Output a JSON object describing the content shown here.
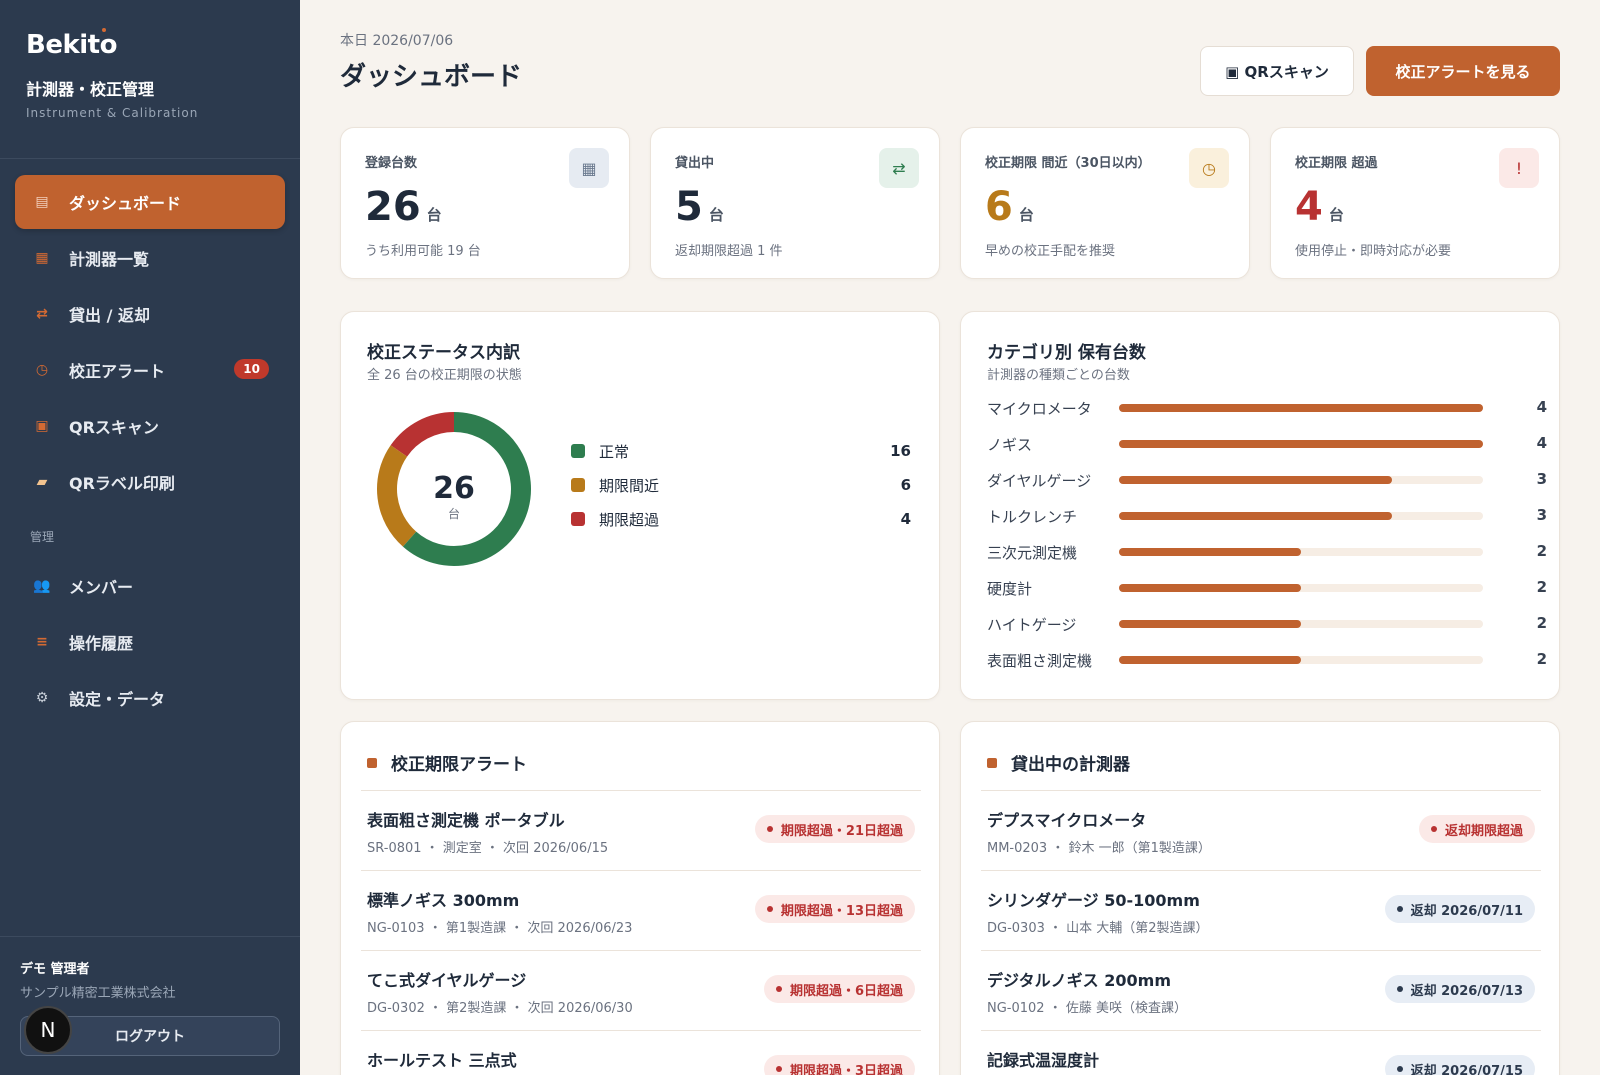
{
  "sidebar": {
    "logo": "Bekito",
    "app_title": "計測器・校正管理",
    "app_subtitle": "Instrument & Calibration",
    "nav": [
      {
        "label": "ダッシュボード",
        "icon": "▤"
      },
      {
        "label": "計測器一覧",
        "icon": "▦"
      },
      {
        "label": "貸出 / 返却",
        "icon": "⇄"
      },
      {
        "label": "校正アラート",
        "icon": "◷",
        "badge": "10"
      },
      {
        "label": "QRスキャン",
        "icon": "▣"
      },
      {
        "label": "QRラベル印刷",
        "icon": "▰"
      }
    ],
    "section_label": "管理",
    "admin_nav": [
      {
        "label": "メンバー",
        "icon": "👥"
      },
      {
        "label": "操作履歴",
        "icon": "≡"
      },
      {
        "label": "設定・データ",
        "icon": "⚙"
      }
    ],
    "user_name": "デモ 管理者",
    "user_org": "サンプル精密工業株式会社",
    "logout_label": "ログアウト",
    "avatar_letter": "N"
  },
  "header": {
    "date": "本日 2026/07/06",
    "title": "ダッシュボード",
    "qr_button": "▣ QRスキャン",
    "alert_button": "校正アラートを見る"
  },
  "stats": [
    {
      "label": "登録台数",
      "value": "26",
      "unit": "台",
      "note": "うち利用可能 19 台",
      "icon": "▦",
      "color": "#1f2a3a",
      "icon_bg": "#e6ebf2",
      "icon_color": "#6b7a8f"
    },
    {
      "label": "貸出中",
      "value": "5",
      "unit": "台",
      "note": "返却期限超過 1 件",
      "icon": "⇄",
      "color": "#1f2a3a",
      "icon_bg": "#e5f1ea",
      "icon_color": "#2e7d4f"
    },
    {
      "label": "校正期限 間近（30日以内）",
      "value": "6",
      "unit": "台",
      "note": "早めの校正手配を推奨",
      "icon": "◷",
      "color": "#b87a1a",
      "icon_bg": "#faf0dc",
      "icon_color": "#b87a1a"
    },
    {
      "label": "校正期限 超過",
      "value": "4",
      "unit": "台",
      "note": "使用停止・即時対応が必要",
      "icon": "!",
      "color": "#b83232",
      "icon_bg": "#fbe9e7",
      "icon_color": "#b83232"
    }
  ],
  "status_panel": {
    "title": "校正ステータス内訳",
    "subtitle": "全 26 台の校正期限の状態",
    "center_value": "26",
    "center_unit": "台"
  },
  "category_panel": {
    "title": "カテゴリ別 保有台数",
    "subtitle": "計測器の種類ごとの台数"
  },
  "chart_data": [
    {
      "type": "pie",
      "categories": [
        "正常",
        "期限間近",
        "期限超過"
      ],
      "values": [
        16,
        6,
        4
      ],
      "colors": [
        "#2e7d4f",
        "#b87a1a",
        "#b83232"
      ]
    },
    {
      "type": "bar",
      "categories": [
        "マイクロメータ",
        "ノギス",
        "ダイヤルゲージ",
        "トルクレンチ",
        "三次元測定機",
        "硬度計",
        "ハイトゲージ",
        "表面粗さ測定機"
      ],
      "values": [
        4,
        4,
        3,
        3,
        2,
        2,
        2,
        2
      ],
      "xlim": [
        0,
        4
      ],
      "color": "#c0622f"
    }
  ],
  "alerts": {
    "title": "校正期限アラート",
    "items": [
      {
        "name": "表面粗さ測定機 ポータブル",
        "meta": "SR-0801 ・ 測定室 ・ 次回 2026/06/15",
        "badge": "期限超過・21日超過"
      },
      {
        "name": "標準ノギス 300mm",
        "meta": "NG-0103 ・ 第1製造課 ・ 次回 2026/06/23",
        "badge": "期限超過・13日超過"
      },
      {
        "name": "てこ式ダイヤルゲージ",
        "meta": "DG-0302 ・ 第2製造課 ・ 次回 2026/06/30",
        "badge": "期限超過・6日超過"
      },
      {
        "name": "ホールテスト 三点式",
        "meta": "",
        "badge": "期限超過・3日超過"
      }
    ]
  },
  "loans": {
    "title": "貸出中の計測器",
    "items": [
      {
        "name": "デプスマイクロメータ",
        "meta": "MM-0203 ・ 鈴木 一郎（第1製造課）",
        "badge": "返却期限超過",
        "kind": "red"
      },
      {
        "name": "シリンダゲージ 50-100mm",
        "meta": "DG-0303 ・ 山本 大輔（第2製造課）",
        "badge": "返却 2026/07/11",
        "kind": "blue"
      },
      {
        "name": "デジタルノギス 200mm",
        "meta": "NG-0102 ・ 佐藤 美咲（検査課）",
        "badge": "返却 2026/07/13",
        "kind": "blue"
      },
      {
        "name": "記録式温湿度計",
        "meta": "",
        "badge": "返却 2026/07/15",
        "kind": "blue"
      }
    ]
  }
}
